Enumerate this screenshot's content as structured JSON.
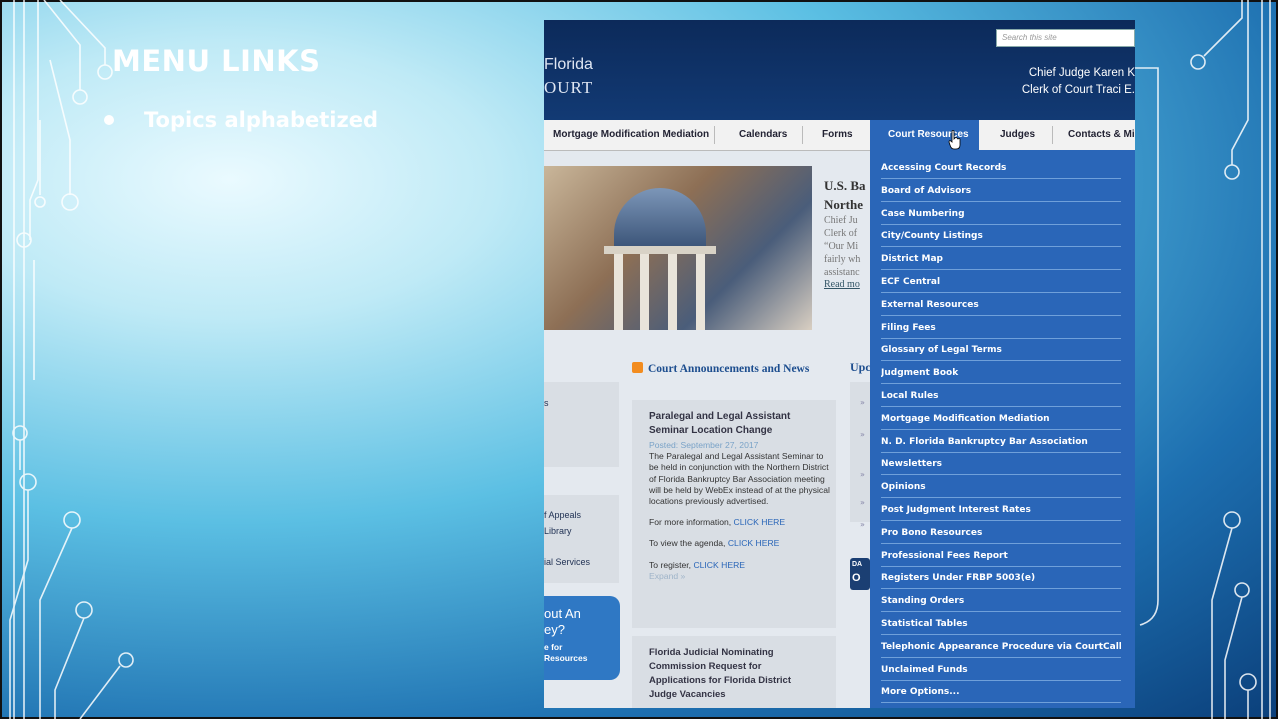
{
  "slide": {
    "title": "MENU LINKS",
    "bullets": [
      "Topics alphabetized"
    ]
  },
  "website": {
    "search_placeholder": "Search this site",
    "state_name": "Florida",
    "court_word": "OURT",
    "chief_judge": "Chief Judge Karen K",
    "clerk": "Clerk of Court Traci E.",
    "nav": [
      "Mortgage Modification Mediation",
      "Calendars",
      "Forms",
      "Court Resources",
      "Judges",
      "Contacts & Mi"
    ],
    "active_nav": "Court Resources",
    "banner": {
      "title_line1": "U.S. Ba",
      "title_line2": "Northe",
      "sub_lines": [
        "Chief Ju",
        "Clerk of",
        "“Our Mi",
        "fairly wh",
        "assistanc"
      ],
      "read_more": "Read mo"
    },
    "left_links": [
      "f Appeals",
      "Library",
      "ial Services"
    ],
    "left_box_marker": "s",
    "left_blue": {
      "line1": "out An",
      "line2": "ey?",
      "line3": "e for",
      "line4": "Resources"
    },
    "announcements": {
      "heading": "Court Announcements and News",
      "card1": {
        "title": "Paralegal and Legal Assistant Seminar Location Change",
        "date": "Posted: September 27, 2017",
        "body": "The Paralegal and Legal Assistant Seminar to be held in conjunction with the Northern District of Florida Bankruptcy Bar Association meeting will be held by WebEx instead of at the physical locations previously advertised.",
        "more_info_text": "For more information,",
        "more_info_link": "CLICK HERE",
        "agenda_text": "To view the agenda,",
        "agenda_link": "CLICK HERE",
        "register_text": "To register,",
        "register_link": "CLICK HERE",
        "expand": "Expand »"
      },
      "card2_title": "Florida Judicial Nominating Commission Request for Applications for Florida District Judge Vacancies"
    },
    "upcoming_heading": "Upc",
    "upcoming_arrows": [
      "»",
      "»",
      "»",
      "»",
      "»"
    ],
    "darkbox_line1": "DA",
    "darkbox_line2": "O",
    "dropdown_items": [
      "Accessing Court Records",
      "Board of Advisors",
      "Case Numbering",
      "City/County Listings",
      "District Map",
      "ECF Central",
      "External Resources",
      "Filing Fees",
      "Glossary of Legal Terms",
      "Judgment Book",
      "Local Rules",
      "Mortgage Modification Mediation",
      "N. D. Florida Bankruptcy Bar Association",
      "Newsletters",
      "Opinions",
      "Post Judgment Interest Rates",
      "Pro Bono Resources",
      "Professional Fees Report",
      "Registers Under FRBP 5003(e)",
      "Standing Orders",
      "Statistical Tables",
      "Telephonic Appearance Procedure via CourtCall",
      "Unclaimed Funds",
      "More Options..."
    ]
  },
  "colors": {
    "dropdown_bg": "#2a66b8",
    "header_bg": "#0c2a5a",
    "slide_accent": "#ffffff"
  }
}
